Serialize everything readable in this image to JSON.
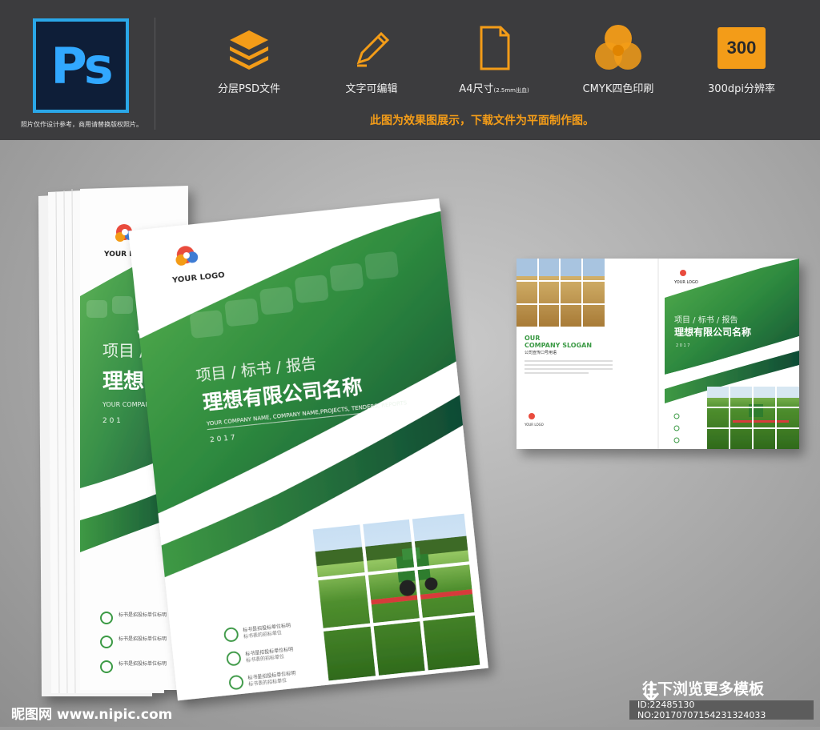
{
  "header": {
    "ps_logo_text": "Ps",
    "ps_note": "照片仅作设计参考，商用请替换版权照片。",
    "features": [
      {
        "icon": "layers-icon",
        "label": "分层PSD文件"
      },
      {
        "icon": "pencil-icon",
        "label": "文字可编辑"
      },
      {
        "icon": "page-icon",
        "label": "A4尺寸",
        "note": "(2.5mm出血)"
      },
      {
        "icon": "cmyk-circles-icon",
        "label": "CMYK四色印刷"
      },
      {
        "icon": "resolution-badge-icon",
        "badge": "300",
        "label": "300dpi分辨率"
      }
    ],
    "notice": "此图为效果图展示，下载文件为平面制作图。",
    "accent_color": "#f39c18"
  },
  "brochure": {
    "logo_text": "YOUR LOGO",
    "category": "项目 / 标书 / 报告",
    "company_cn": "理想有限公司名称",
    "company_en": "YOUR COMPANY NAME, COMPANY NAME,PROJECTS, TENDERS, REPORTS",
    "year": "2 0 1 7",
    "back_cn": "项目 / 标",
    "back_company": "理想有",
    "back_en": "YOUR COMPANY NAME,",
    "back_year": "2 0 1",
    "bullets": [
      "标书是招投标单位标明",
      "标书是招投标单位标明",
      "标书是招投标单位标明"
    ],
    "bullet_sub": [
      "标书表的招标单位",
      "标书表的招标单位",
      "标书表的招标单位"
    ],
    "brand_green": "#2f8a3e"
  },
  "spread": {
    "slogan_en_1": "OUR",
    "slogan_en_2": "COMPANY SLOGAN",
    "slogan_cn": "公司宣传口号用语",
    "logo_text": "YOUR LOGO",
    "category": "项目 / 标书 / 报告",
    "company_cn": "理想有限公司名称",
    "year": "2 0 1 7"
  },
  "footer": {
    "site": "昵图网 www.nipic.com",
    "download_label": "往下浏览更多模板",
    "id_text": "ID:22485130 NO:20170707154231324033"
  }
}
